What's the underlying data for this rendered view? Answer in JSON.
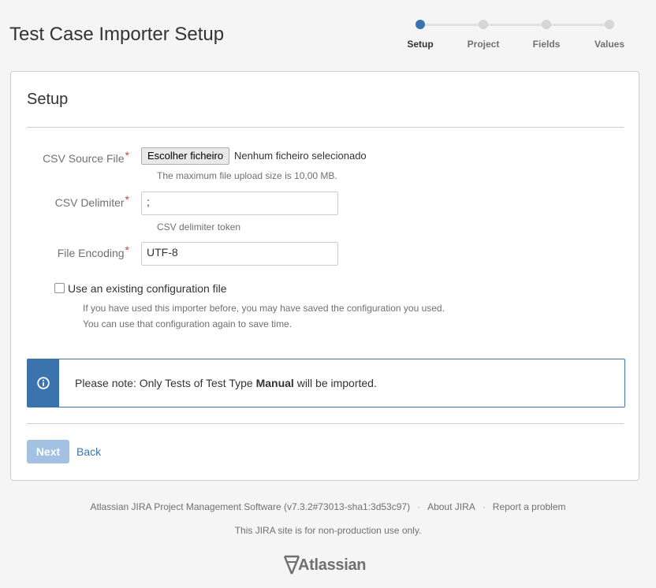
{
  "header": {
    "title": "Test Case Importer Setup"
  },
  "tracker": {
    "steps": [
      {
        "label": "Setup",
        "current": true
      },
      {
        "label": "Project",
        "current": false
      },
      {
        "label": "Fields",
        "current": false
      },
      {
        "label": "Values",
        "current": false
      }
    ],
    "current_color": "#3b73af"
  },
  "panel": {
    "title": "Setup"
  },
  "form": {
    "csv_source": {
      "label": "CSV Source File",
      "required_mark": "*",
      "button_label": "Escolher ficheiro",
      "status": "Nenhum ficheiro selecionado",
      "description": "The maximum file upload size is 10,00 MB."
    },
    "csv_delimiter": {
      "label": "CSV Delimiter",
      "required_mark": "*",
      "value": ";",
      "description": "CSV delimiter token"
    },
    "file_encoding": {
      "label": "File Encoding",
      "required_mark": "*",
      "value": "UTF-8"
    },
    "existing_config": {
      "label": "Use an existing configuration file",
      "checked": false,
      "description_line1": "If you have used this importer before, you may have saved the configuration you used.",
      "description_line2": "You can use that configuration again to save time."
    }
  },
  "message": {
    "icon": "info-icon",
    "text_before": "Please note: Only Tests of Test Type ",
    "text_bold": "Manual",
    "text_after": " will be imported.",
    "accent_color": "#3b73af"
  },
  "actions": {
    "next_label": "Next",
    "back_label": "Back"
  },
  "footer": {
    "software": "Atlassian JIRA Project Management Software (v7.3.2#73013-sha1:3d53c97)",
    "separator": "·",
    "about": "About JIRA",
    "report": "Report a problem",
    "notice": "This JIRA site is for non-production use only.",
    "logo_text": "Atlassian"
  }
}
